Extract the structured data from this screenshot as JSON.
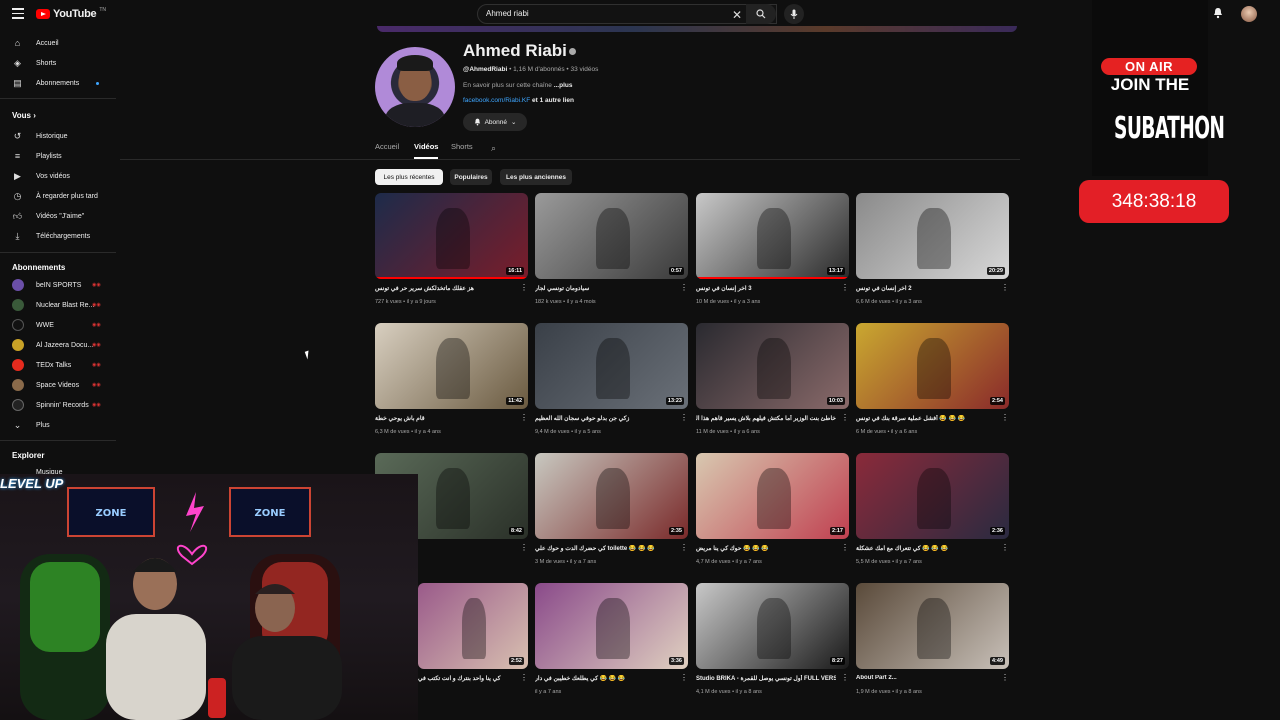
{
  "topbar": {
    "logo_text": "YouTube",
    "logo_sup": "TN",
    "search_value": "Ahmed riabi",
    "colors": {
      "brand": "#ff0000",
      "link": "#3ea6ff"
    }
  },
  "sidebar": {
    "main": [
      {
        "label": "Accueil",
        "icon": "home-icon"
      },
      {
        "label": "Shorts",
        "icon": "shorts-icon"
      },
      {
        "label": "Abonnements",
        "icon": "subscriptions-icon"
      }
    ],
    "you_heading": "Vous",
    "you_items": [
      {
        "label": "Historique",
        "icon": "history-icon"
      },
      {
        "label": "Playlists",
        "icon": "playlists-icon"
      },
      {
        "label": "Vos vidéos",
        "icon": "your-videos-icon"
      },
      {
        "label": "À regarder plus tard",
        "icon": "watch-later-icon"
      },
      {
        "label": "Vidéos \"J'aime\"",
        "icon": "liked-icon"
      },
      {
        "label": "Téléchargements",
        "icon": "downloads-icon"
      }
    ],
    "subs_heading": "Abonnements",
    "subs": [
      {
        "label": "beIN SPORTS",
        "color": "#6b4fa8"
      },
      {
        "label": "Nuclear Blast Re...",
        "color": "#3a5a3a"
      },
      {
        "label": "WWE",
        "color": "#111111"
      },
      {
        "label": "Al Jazeera Docu...",
        "color": "#c9a227"
      },
      {
        "label": "TEDx Talks",
        "color": "#e62b1e"
      },
      {
        "label": "Space Videos",
        "color": "#8a6a4a"
      },
      {
        "label": "Spinnin' Records",
        "color": "#222222"
      }
    ],
    "more_label": "Plus",
    "explore_heading": "Explorer",
    "music_label": "Musique"
  },
  "channel": {
    "name": "Ahmed Riabi",
    "handle": "@AhmedRiabi",
    "stats": " • 1,16 M d'abonnés • 33 vidéos",
    "about": "En savoir plus sur cette chaîne ",
    "about_more": "...plus",
    "link": "facebook.com/Riabi.KF",
    "link_more": " et 1 autre lien",
    "subscribe_label": "Abonné"
  },
  "tabs": [
    {
      "label": "Accueil"
    },
    {
      "label": "Vidéos"
    },
    {
      "label": "Shorts"
    }
  ],
  "chips": [
    {
      "label": "Les plus récentes"
    },
    {
      "label": "Populaires"
    },
    {
      "label": "Les plus anciennes"
    }
  ],
  "videos": [
    {
      "title": "هز عقلك ماتخدلكش سرير حر في تونس",
      "meta": "727 k vues • il y a 9 jours",
      "duration": "16:11",
      "progress": 1.0,
      "rtl": true
    },
    {
      "title": "سيادومان تونسي لجار",
      "meta": "182 k vues • il y a 4 mois",
      "duration": "0:57",
      "progress": 0,
      "rtl": true
    },
    {
      "title": "3 آخر إنسان في تونس",
      "meta": "10 M de vues • il y a 3 ans",
      "duration": "13:17",
      "progress": 1.0,
      "rtl": true
    },
    {
      "title": "2 آخر إنسان في تونس",
      "meta": "6,6 M de vues • il y a 3 ans",
      "duration": "20:29",
      "progress": 0,
      "rtl": true
    },
    {
      "title": "قام باش يوحي خطة",
      "meta": "6,3 M de vues • il y a 4 ans",
      "duration": "11:42",
      "progress": 0,
      "rtl": true
    },
    {
      "title": "زكي جن بدلو حوفي سجان الله العظيم",
      "meta": "9,4 M de vues • il y a 5 ans",
      "duration": "13:23",
      "progress": 0,
      "rtl": true
    },
    {
      "title": "خاطئ بنت الوزير أما مكتش فيلهم بلاش يسير قاهم هذا الكل",
      "meta": "11 M de vues • il y a 6 ans",
      "duration": "10:03",
      "progress": 0,
      "rtl": true
    },
    {
      "title": "😂 😂 😂 أفشل عملية سرقة بنك في تونس",
      "meta": "6 M de vues • il y a 6 ans",
      "duration": "2:54",
      "progress": 0,
      "rtl": true
    },
    {
      "title": "😂 😂 😂",
      "meta": "il y a 6 ans",
      "duration": "8:42",
      "progress": 0,
      "rtl": true
    },
    {
      "title": "😂 😂 😂 toilette كي حضرك الدت و حوك علي",
      "meta": "3 M de vues • il y a 7 ans",
      "duration": "2:35",
      "progress": 0,
      "rtl": true
    },
    {
      "title": "😂 😂 😂 حوك كي ينا مريض",
      "meta": "4,7 M de vues • il y a 7 ans",
      "duration": "2:17",
      "progress": 0,
      "rtl": true
    },
    {
      "title": "😂 😂 😂 كي تتعراك مع امك عشكلة",
      "meta": "5,5 M de vues • il y a 7 ans",
      "duration": "2:36",
      "progress": 0,
      "rtl": true
    },
    {
      "title": "كي ينا واحد بنترك و انت تكتب في",
      "meta": "",
      "duration": "2:52",
      "progress": 0,
      "rtl": true
    },
    {
      "title": "😂 😂 😂 كي يطلعك خطيبن في دار",
      "meta": "il y a 7 ans",
      "duration": "3:36",
      "progress": 0,
      "rtl": true
    },
    {
      "title": "Studio BRIKA - أول تونسي يوصل للقمرة FULL VERSION 😂 😂 😂",
      "meta": "4,1 M de vues • il y a 8 ans",
      "duration": "8:27",
      "progress": 0,
      "rtl": false
    },
    {
      "title": "About Part 2...",
      "meta": "1,9 M de vues • il y a 8 ans",
      "duration": "4:49",
      "progress": 0,
      "rtl": false
    }
  ],
  "overlay": {
    "on_air": "ON AIR",
    "join": "JOIN THE",
    "subathon": "SUBATHON",
    "timer": "348:38:18",
    "webcam_text": "LEVEL UP"
  }
}
